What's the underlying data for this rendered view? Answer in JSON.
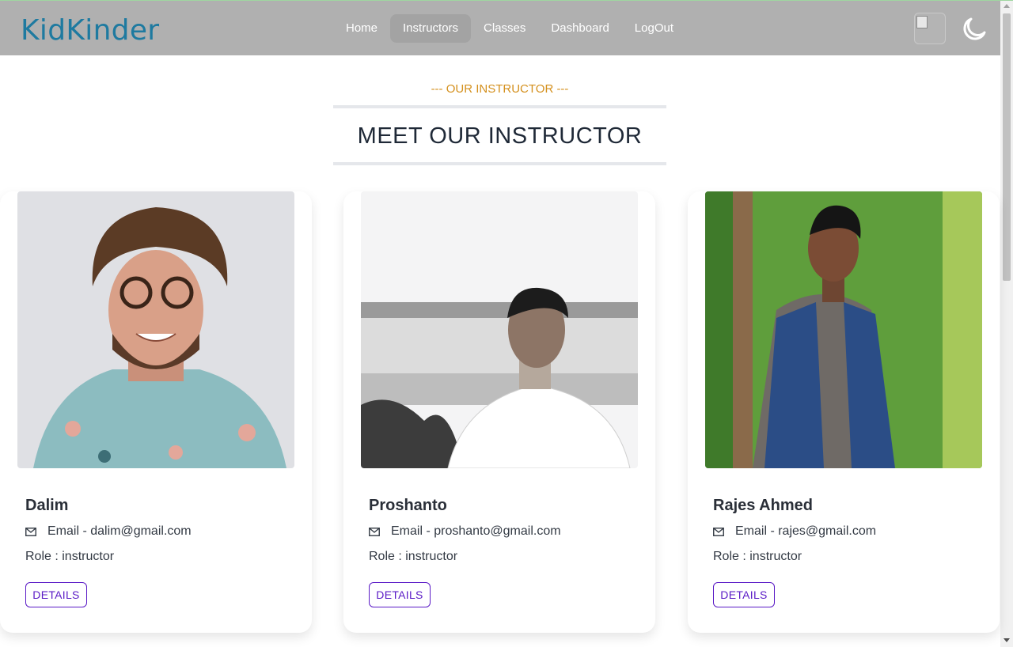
{
  "app": {
    "brand": "KidKinder"
  },
  "nav": {
    "items": [
      {
        "label": "Home",
        "active": false
      },
      {
        "label": "Instructors",
        "active": true
      },
      {
        "label": "Classes",
        "active": false
      },
      {
        "label": "Dashboard",
        "active": false
      },
      {
        "label": "LogOut",
        "active": false
      }
    ],
    "theme_icon": "moon-icon"
  },
  "section": {
    "subtitle": "--- OUR INSTRUCTOR ---",
    "title": "MEET OUR INSTRUCTOR"
  },
  "instructors": [
    {
      "name": "Dalim",
      "email": "Email - dalim@gmail.com",
      "role": "Role : instructor",
      "button": "DETAILS"
    },
    {
      "name": "Proshanto",
      "email": "Email - proshanto@gmail.com",
      "role": "Role : instructor",
      "button": "DETAILS"
    },
    {
      "name": "Rajes Ahmed",
      "email": "Email - rajes@gmail.com",
      "role": "Role : instructor",
      "button": "DETAILS"
    }
  ],
  "colors": {
    "navbar": "#b0b0b0",
    "brand": "#1e7aa0",
    "accent": "#d4901d",
    "button": "#5a1ac6"
  }
}
